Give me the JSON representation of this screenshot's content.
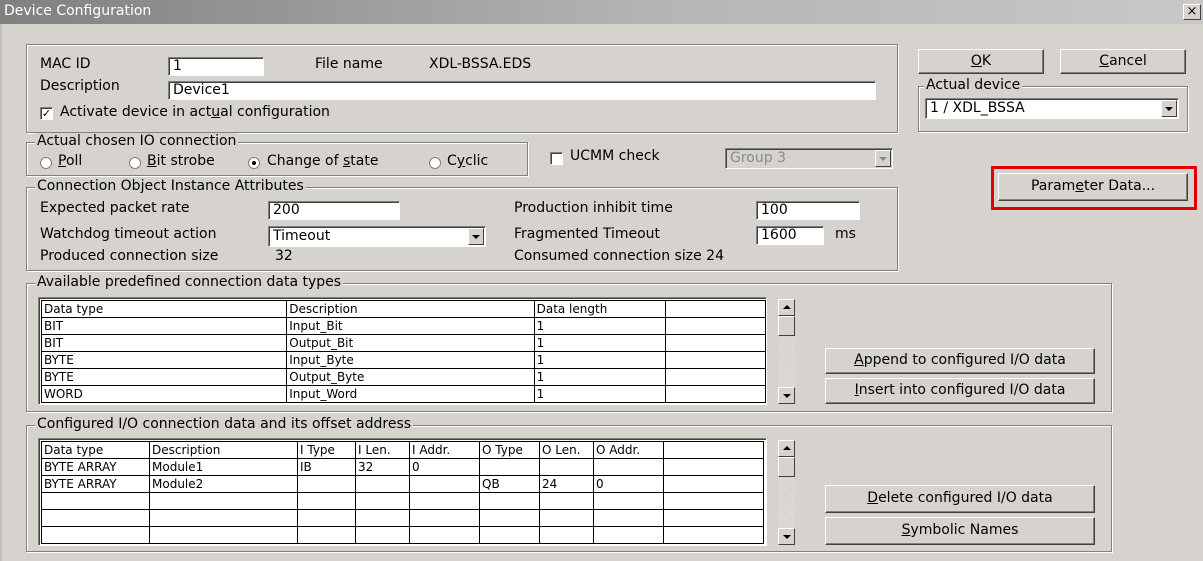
{
  "window": {
    "title": "Device Configuration",
    "close": "×"
  },
  "device": {
    "mac_id_label": "MAC ID",
    "mac_id": "1",
    "file_name_label": "File name",
    "file_name": "XDL-BSSA.EDS",
    "description_label": "Description",
    "description": "Device1",
    "activate": {
      "pre": "Activate device in act",
      "ul": "u",
      "post": "al configuration",
      "checked": true,
      "mark": "✓"
    }
  },
  "buttons": {
    "ok": {
      "ul": "O",
      "rest": "K"
    },
    "cancel": {
      "ul": "C",
      "rest": "ancel"
    },
    "parameter": {
      "pre": "Param",
      "ul": "e",
      "post": "ter Data..."
    },
    "append": {
      "ul": "A",
      "rest": "ppend to configured I/O data"
    },
    "insert": {
      "ul": "I",
      "rest": "nsert into configured I/O data"
    },
    "delete": {
      "ul": "D",
      "rest": "elete configured I/O data"
    },
    "symbolic": {
      "ul": "S",
      "rest": "ymbolic Names"
    }
  },
  "actual_device": {
    "legend": "Actual device",
    "value": "1 / XDL_BSSA"
  },
  "io_connection": {
    "legend": "Actual chosen IO connection",
    "options": [
      {
        "ul": "P",
        "rest": "oll",
        "selected": false
      },
      {
        "ul": "B",
        "rest": "it strobe",
        "selected": false
      },
      {
        "pre": "Change of ",
        "ul": "s",
        "rest": "tate",
        "selected": true
      },
      {
        "pre": "C",
        "ul": "y",
        "rest": "clic",
        "selected": false
      }
    ],
    "ucmm_label": "UCMM check",
    "ucmm_checked": false,
    "group_value": "Group 3"
  },
  "attributes": {
    "legend": "Connection Object Instance Attributes",
    "expected_packet_rate_label": "Expected packet rate",
    "expected_packet_rate": "200",
    "watchdog_label": "Watchdog timeout action",
    "watchdog_value": "Timeout",
    "produced_size_label": "Produced connection size",
    "produced_size": "32",
    "production_inhibit_label": "Production inhibit time",
    "production_inhibit": "100",
    "fragmented_label": "Fragmented Timeout",
    "fragmented": "1600",
    "fragmented_unit": "ms",
    "consumed_size_label": "Consumed connection size",
    "consumed_size": "24"
  },
  "available": {
    "legend": "Available predefined connection data types",
    "columns": [
      "Data type",
      "Description",
      "Data length"
    ],
    "rows": [
      [
        "BIT",
        "Input_Bit",
        "1"
      ],
      [
        "BIT",
        "Output_Bit",
        "1"
      ],
      [
        "BYTE",
        "Input_Byte",
        "1"
      ],
      [
        "BYTE",
        "Output_Byte",
        "1"
      ],
      [
        "WORD",
        "Input_Word",
        "1"
      ]
    ]
  },
  "configured": {
    "legend": "Configured I/O connection data and its offset address",
    "columns": [
      "Data type",
      "Description",
      "I Type",
      "I Len.",
      "I Addr.",
      "O Type",
      "O Len.",
      "O Addr."
    ],
    "rows": [
      [
        "BYTE ARRAY",
        "Module1",
        "IB",
        "32",
        "0",
        "",
        "",
        ""
      ],
      [
        "BYTE ARRAY",
        "Module2",
        "",
        "",
        "",
        "QB",
        "24",
        "0"
      ],
      [
        "",
        "",
        "",
        "",
        "",
        "",
        "",
        ""
      ],
      [
        "",
        "",
        "",
        "",
        "",
        "",
        "",
        ""
      ],
      [
        "",
        "",
        "",
        "",
        "",
        "",
        "",
        ""
      ]
    ]
  }
}
